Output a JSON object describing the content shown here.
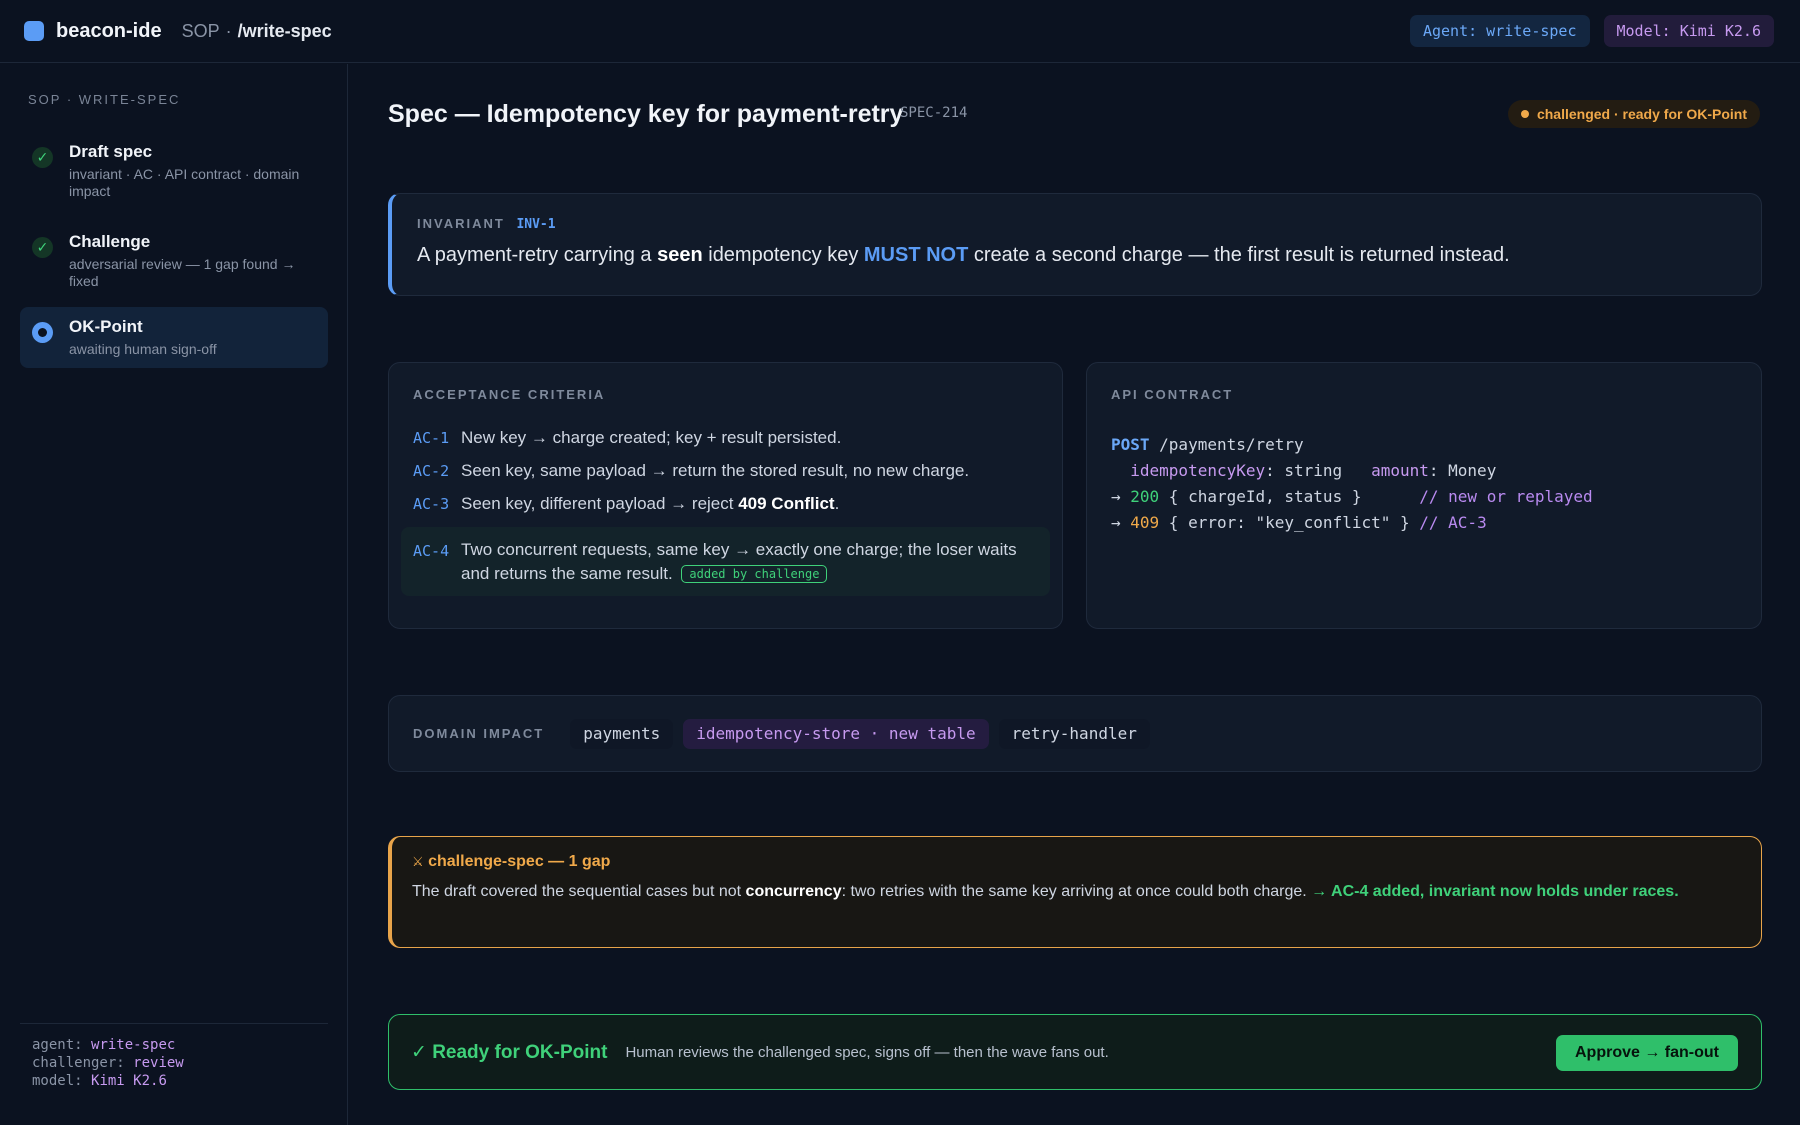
{
  "topbar": {
    "app_name": "beacon-ide",
    "crumb_parent": "SOP",
    "crumb_sep": "·",
    "crumb_current": "/write-spec",
    "agent_pill": "Agent: write-spec",
    "model_pill": "Model: Kimi K2.6"
  },
  "sidebar": {
    "header": "SOP · WRITE-SPEC",
    "steps": [
      {
        "title": "Draft spec",
        "sub": "invariant · AC · API contract · domain impact",
        "state": "done",
        "icon": "check-icon"
      },
      {
        "title": "Challenge",
        "sub": "adversarial review — 1 gap found → fixed",
        "state": "done",
        "icon": "check-icon"
      },
      {
        "title": "OK-Point",
        "sub": "awaiting human sign-off",
        "state": "active",
        "icon": "radio-active-icon"
      }
    ],
    "check_glyph": "✓",
    "footer": {
      "agent_label": "agent:",
      "agent_value": "write-spec",
      "challenger_label": "challenger:",
      "challenger_value": "review",
      "model_label": "model:",
      "model_value": "Kimi K2.6"
    }
  },
  "main": {
    "title": "Spec — Idempotency key for payment-retry",
    "spec_id": "SPEC-214",
    "status": "challenged · ready for OK-Point",
    "invariant": {
      "label": "INVARIANT",
      "id": "INV-1",
      "text_1": "A payment-retry carrying a ",
      "text_bold": "seen",
      "text_2": " idempotency key ",
      "text_must": "MUST NOT",
      "text_3": " create a second charge — the first result is returned instead."
    },
    "acceptance": {
      "label": "ACCEPTANCE CRITERIA",
      "items": [
        {
          "id": "AC-1",
          "text": "New key → charge created; key + result persisted."
        },
        {
          "id": "AC-2",
          "text": "Seen key, same payload → return the stored result, no new charge."
        },
        {
          "id": "AC-3",
          "text_1": "Seen key, different payload → reject ",
          "text_bold": "409 Conflict",
          "text_2": "."
        },
        {
          "id": "AC-4",
          "text": "Two concurrent requests, same key → exactly one charge; the loser waits and returns the same result.",
          "tag": "added by challenge"
        }
      ]
    },
    "api": {
      "label": "API CONTRACT",
      "method": "POST",
      "path": " /payments/retry",
      "param1_name": "idempotencyKey",
      "param1_type": ": string",
      "param2_name": "amount",
      "param2_type": ": Money",
      "arrow": "→ ",
      "resp1_code": "200",
      "resp1_body": " { chargeId, status }      ",
      "resp1_comment": "// new or replayed",
      "resp2_code": "409",
      "resp2_body": " { error: \"key_conflict\" } ",
      "resp2_comment": "// AC-3"
    },
    "domain": {
      "label": "DOMAIN IMPACT",
      "chips": [
        "payments",
        "idempotency-store · new table",
        "retry-handler"
      ]
    },
    "challenge": {
      "icon": "swords-icon",
      "glyph": "⚔",
      "title": "challenge-spec — 1 gap",
      "text_1": "The draft covered the sequential cases but not ",
      "text_bold": "concurrency",
      "text_2": ": two retries with the same key arriving at once could both charge. ",
      "text_fix": "→ AC-4 added, invariant now holds under races."
    },
    "ready": {
      "title": "✓ Ready for OK-Point",
      "text": "Human reviews the challenged spec, signs off — then the wave fans out.",
      "button": "Approve → fan-out"
    }
  },
  "colors": {
    "background": "#0b1220",
    "accent_blue": "#5b9cf5",
    "accent_purple": "#c79af0",
    "success_green": "#3fd17a",
    "warning_orange": "#f0a94a"
  }
}
